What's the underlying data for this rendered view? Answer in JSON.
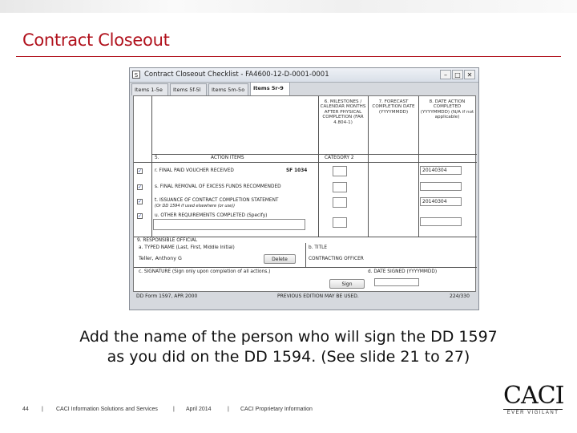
{
  "slide": {
    "title": "Contract Closeout",
    "caption_line1": "Add the name of the person who will sign the DD 1597",
    "caption_line2": "as you did on the DD 1594. (See slide 21 to 27)",
    "accent_color": "#b1121d"
  },
  "window": {
    "title": "Contract Closeout Checklist - FA4600-12-D-0001-0001",
    "icon_label": "S",
    "minimize_icon": "minimize-icon",
    "maximize_icon": "maximize-icon",
    "close_icon": "close-icon",
    "tabs": [
      "Items 1-5e",
      "Items 5f-5l",
      "Items 5m-5o",
      "Items 5r-9"
    ],
    "active_tab": 3
  },
  "form": {
    "col6_header": "6. MILESTONES / CALENDAR MONTHS AFTER PHYSICAL COMPLETION (FAR 4.804-1)",
    "col7_header": "7. FORECAST COMPLETION DATE (YYYYMMDD)",
    "col8_header": "8. DATE ACTION COMPLETED (YYYYMMDD) (N/A if not applicable)",
    "category_label": "CATEGORY 2",
    "col5_num": "5.",
    "col5_header": "ACTION ITEMS",
    "items": [
      {
        "checked": true,
        "label": "r. FINAL PAID VOUCHER RECEIVED",
        "note": "SF 1034",
        "date_completed": "20140304"
      },
      {
        "checked": true,
        "label": "s. FINAL REMOVAL OF EXCESS FUNDS RECOMMENDED",
        "note": "",
        "date_completed": ""
      },
      {
        "checked": true,
        "label": "t. ISSUANCE OF CONTRACT COMPLETION STATEMENT",
        "note": "(Or DD 1594 if used elsewhere (or use))",
        "date_completed": "20140304"
      },
      {
        "checked": true,
        "label": "u. OTHER REQUIREMENTS COMPLETED (Specify)",
        "note": "",
        "date_completed": ""
      }
    ],
    "responsible_header": "9. RESPONSIBLE OFFICIAL",
    "typed_name_label": "a. TYPED NAME (Last, First, Middle Initial)",
    "typed_name_value": "Teller, Anthony G",
    "delete_button": "Delete",
    "title_label": "b. TITLE",
    "title_value": "CONTRACTING OFFICER",
    "signature_label": "c. SIGNATURE (Sign only upon completion of all actions.)",
    "date_signed_label": "d. DATE SIGNED (YYYYMMDD)",
    "sign_button": "Sign"
  },
  "form_footer": {
    "form_id": "DD Form 1597, APR 2000",
    "edition": "PREVIOUS EDITION MAY BE USED.",
    "page": "224/330"
  },
  "slide_footer": {
    "page_number": "44",
    "sep": "|",
    "company": "CACI Information Solutions and Services",
    "date": "April 2014",
    "notice": "CACI Proprietary Information"
  },
  "logo": {
    "text": "CACI",
    "tagline": "EVER VIGILANT"
  }
}
